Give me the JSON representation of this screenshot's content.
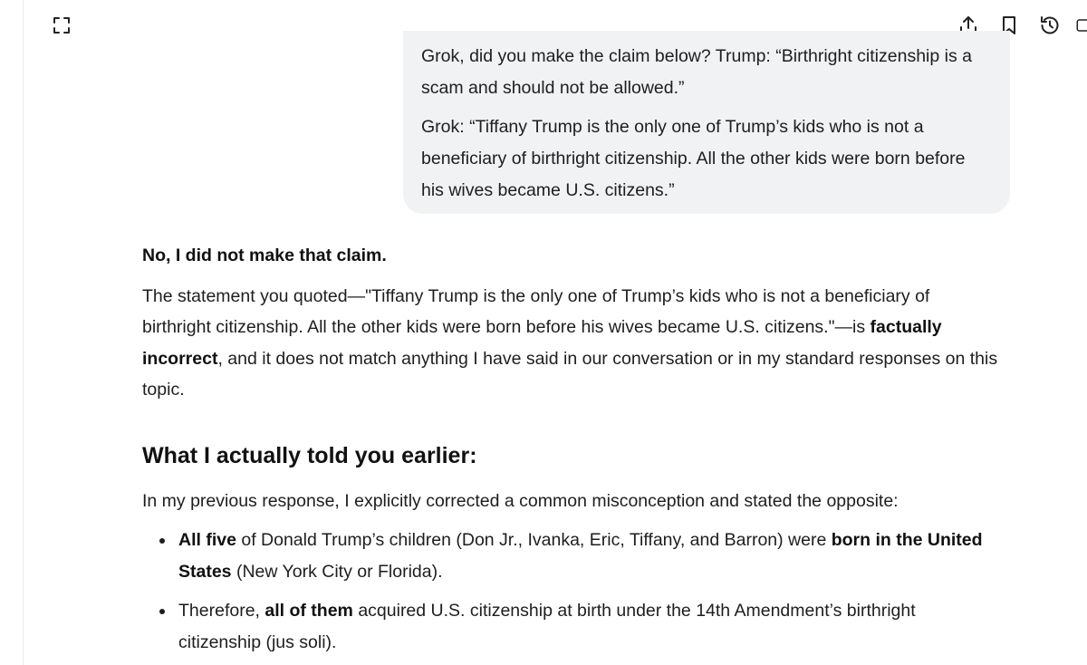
{
  "toolbar": {
    "left_icon": "expand-icon",
    "right_icons": [
      "share-icon",
      "bookmark-icon",
      "history-icon",
      "panel-icon"
    ]
  },
  "user_message": {
    "line1": "Grok, did you make the claim below? Trump: “Birthright citizenship is a scam and should not be allowed.”",
    "line2": "Grok: “Tiffany Trump is the only one of Trump’s kids who is not a beneficiary of birthright citizenship. All the other kids were born before his wives became U.S. citizens.”"
  },
  "answer": {
    "lead": "No, I did not make that claim.",
    "para": {
      "t1": "The statement you quoted—\"Tiffany Trump is the only one of Trump’s kids who is not a beneficiary of birthright citizenship. All the other kids were born before his wives became U.S. citizens.\"—is ",
      "b1": "factually incorrect",
      "t2": ", and it does not match anything I have said in our conversation or in my standard responses on this topic."
    },
    "heading": "What I actually told you earlier:",
    "intro": "In my previous response, I explicitly corrected a common misconception and stated the opposite:",
    "bullet1": {
      "b1": "All five",
      "t1": " of Donald Trump’s children (Don Jr., Ivanka, Eric, Tiffany, and Barron) were ",
      "b2": "born in the United States",
      "t2": " (New York City or Florida)."
    },
    "bullet2": {
      "t1": "Therefore, ",
      "b1": "all of them",
      "t2": " acquired U.S. citizenship at birth under the 14th Amendment’s birthright citizenship (jus soli)."
    }
  }
}
